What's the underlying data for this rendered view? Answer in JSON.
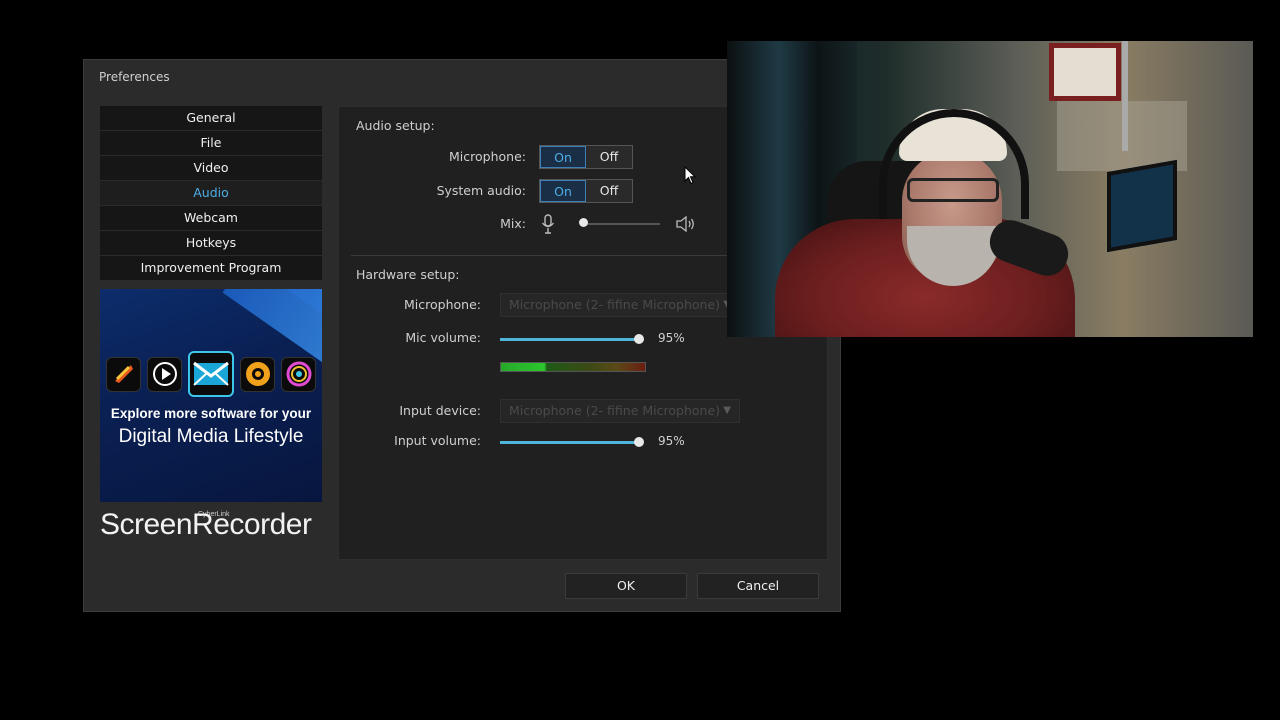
{
  "dialog": {
    "title": "Preferences",
    "nav": [
      "General",
      "File",
      "Video",
      "Audio",
      "Webcam",
      "Hotkeys",
      "Improvement Program"
    ],
    "active_nav": "Audio",
    "promo": {
      "line1": "Explore more software for your",
      "line2": "Digital Media Lifestyle"
    },
    "brand_small": "CyberLink",
    "brand": "ScreenRecorder",
    "audio_setup": {
      "heading": "Audio setup:",
      "microphone_label": "Microphone:",
      "system_audio_label": "System audio:",
      "mix_label": "Mix:",
      "on_label": "On",
      "off_label": "Off",
      "microphone_state": "On",
      "system_audio_state": "On",
      "mix_level": 0.0
    },
    "hardware_setup": {
      "heading": "Hardware setup:",
      "microphone_label": "Microphone:",
      "microphone_value": "Microphone (2- fifine Microphone)",
      "mic_volume_label": "Mic volume:",
      "mic_volume": "95%",
      "input_device_label": "Input device:",
      "input_device_value": "Microphone (2- fifine Microphone)",
      "input_volume_label": "Input volume:",
      "input_volume": "95%"
    },
    "ok_label": "OK",
    "cancel_label": "Cancel"
  },
  "colors": {
    "accent": "#4eaee8",
    "slider_fill": "#4fb6da",
    "dialog_bg": "#2b2b2b",
    "panel_bg": "#202020"
  },
  "icons": [
    "microphone-icon",
    "speaker-icon",
    "dropdown-arrow-icon",
    "mouse-cursor-icon"
  ]
}
